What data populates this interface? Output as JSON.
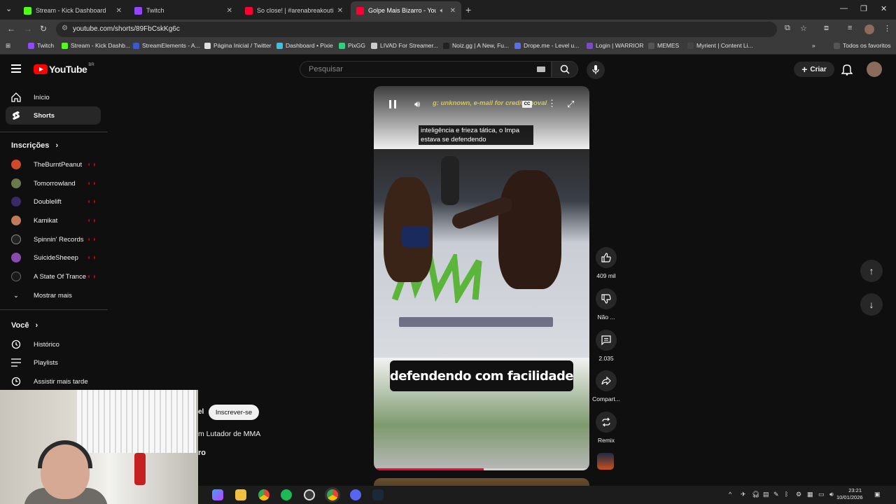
{
  "browser": {
    "tabs": [
      {
        "title": "Stream - Kick Dashboard",
        "color": "#53fc18",
        "active": false
      },
      {
        "title": "Twitch",
        "color": "#9146ff",
        "active": false
      },
      {
        "title": "So close! | #arenabreakoutinfini",
        "color": "#ff0033",
        "active": false
      },
      {
        "title": "Golpe Mais Bizarro - YouTube",
        "color": "#ff0033",
        "active": true
      }
    ],
    "url": "youtube.com/shorts/89FbCskKg6c",
    "bookmarks": [
      {
        "label": "Twitch",
        "color": "#9146ff"
      },
      {
        "label": "Stream - Kick Dashb...",
        "color": "#53fc18"
      },
      {
        "label": "StreamElements - A...",
        "color": "#3a57d6"
      },
      {
        "label": "Página Inicial / Twitter",
        "color": "#e0e0e0"
      },
      {
        "label": "Dashboard • Pixie",
        "color": "#39c3e5"
      },
      {
        "label": "PixGG",
        "color": "#2ad27e"
      },
      {
        "label": "LIVAD For Streamer...",
        "color": "#cccccc"
      },
      {
        "label": "Noiz.gg | A New, Fu...",
        "color": "#222222"
      },
      {
        "label": "Drope.me - Level u...",
        "color": "#5a6cf0"
      },
      {
        "label": "Login | WARRIOR",
        "color": "#7a4cc9"
      },
      {
        "label": "MEMES",
        "color": "#555555"
      },
      {
        "label": "Myrient | Content Li...",
        "color": "#444444"
      }
    ],
    "all_favorites": "Todos os favoritos"
  },
  "header": {
    "logo_text": "YouTube",
    "country": "BR",
    "search_placeholder": "Pesquisar",
    "create_label": "Criar"
  },
  "sidebar": {
    "main": [
      {
        "label": "Início",
        "icon": "home-icon"
      },
      {
        "label": "Shorts",
        "icon": "shorts-icon",
        "active": true
      }
    ],
    "subscriptions_title": "Inscrições",
    "subscriptions": [
      {
        "label": "TheBurntPeanut",
        "color": "#d04a2a"
      },
      {
        "label": "Tomorrowland",
        "color": "#6a7a4a"
      },
      {
        "label": "Doublelift",
        "color": "#3a2a66"
      },
      {
        "label": "Kamikat",
        "color": "#c07a5a"
      },
      {
        "label": "Spinnin' Records",
        "color": "#222222"
      },
      {
        "label": "SuicideSheeep",
        "color": "#8a4ab0"
      },
      {
        "label": "A State Of Trance",
        "color": "#1a1a1a"
      }
    ],
    "show_more": "Mostrar mais",
    "you_title": "Você",
    "you_items": [
      {
        "label": "Histórico",
        "icon": "history-icon"
      },
      {
        "label": "Playlists",
        "icon": "playlists-icon"
      },
      {
        "label": "Assistir mais tarde",
        "icon": "watch-later-icon"
      }
    ]
  },
  "player": {
    "ticker": "g: unknown, e-mail for cred/removal",
    "cc_label": "CC",
    "caption": "inteligência e frieza tática, o Impa estava se defendendo",
    "big_subtitle": "defendendo com facilidade",
    "progress": 0.51
  },
  "actions": [
    {
      "icon": "like-icon",
      "label": "409 mil"
    },
    {
      "icon": "dislike-icon",
      "label": "Não ..."
    },
    {
      "icon": "comment-icon",
      "label": "2.035"
    },
    {
      "icon": "share-icon",
      "label": "Compart..."
    },
    {
      "icon": "remix-icon",
      "label": "Remix"
    }
  ],
  "channel": {
    "name_fragment": "el",
    "subscribe_label": "Inscrever-se",
    "description_fragment": "m Lutador de MMA",
    "sound_fragment": "ro"
  },
  "taskbar": {
    "time": "23:21",
    "date": "10/01/2026"
  }
}
